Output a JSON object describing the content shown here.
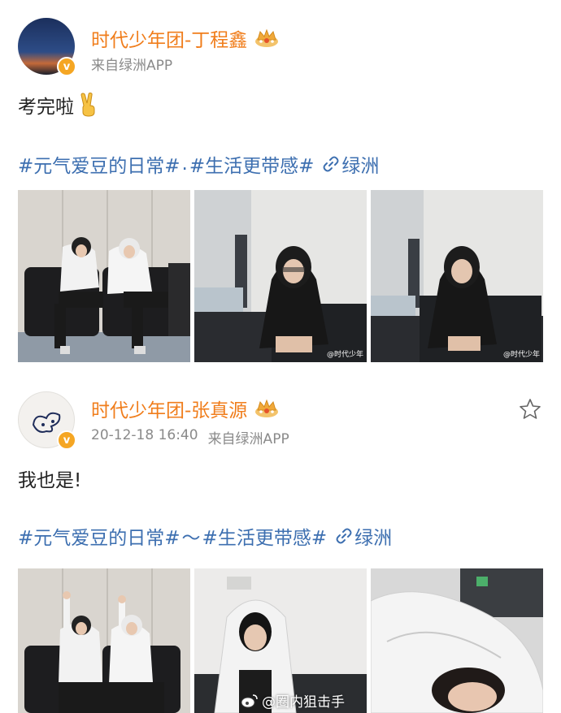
{
  "posts": [
    {
      "username": "时代少年团-丁程鑫",
      "source": "来自绿洲APP",
      "body": "考完啦",
      "tags": [
        "#元气爱豆的日常#",
        ".",
        "#生活更带感#"
      ],
      "link_label": "绿洲",
      "photo_watermark": "@时代少年",
      "images": [
        "two-people-hoodies-sofa",
        "person-black-hoodie-sofa",
        "person-black-hoodie-sofa-2"
      ]
    },
    {
      "username": "时代少年团-张真源",
      "timestamp": "20-12-18 16:40",
      "source": "来自绿洲APP",
      "body": "我也是!",
      "tags": [
        "#元气爱豆的日常#",
        "～",
        "#生活更带感#"
      ],
      "link_label": "绿洲",
      "images": [
        "two-people-raising-fists",
        "person-white-hoodie",
        "white-hood-closeup"
      ]
    }
  ],
  "watermark": "@圈内狙击手",
  "colors": {
    "username": "#f07d1b",
    "tag": "#3d6fb0",
    "meta": "#8a8a8a",
    "badge": "#f5a623"
  }
}
